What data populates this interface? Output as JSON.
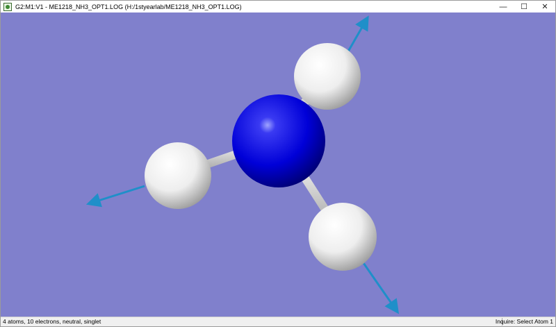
{
  "window": {
    "title": "G2:M1:V1 - ME1218_NH3_OPT1.LOG (H:/1styearlab/ME1218_NH3_OPT1.LOG)",
    "controls": {
      "minimize": "—",
      "maximize": "☐",
      "close": "✕"
    }
  },
  "viewport": {
    "background": "#8080cc",
    "molecule": "NH3",
    "atoms": [
      {
        "element": "N",
        "color": "#0000ee"
      },
      {
        "element": "H",
        "color": "#f2f2f2"
      },
      {
        "element": "H",
        "color": "#f2f2f2"
      },
      {
        "element": "H",
        "color": "#f2f2f2"
      }
    ],
    "vector_color": "#1f8fc9"
  },
  "status": {
    "left": "4 atoms, 10 electrons, neutral, singlet",
    "right": "Inquire: Select Atom 1"
  }
}
